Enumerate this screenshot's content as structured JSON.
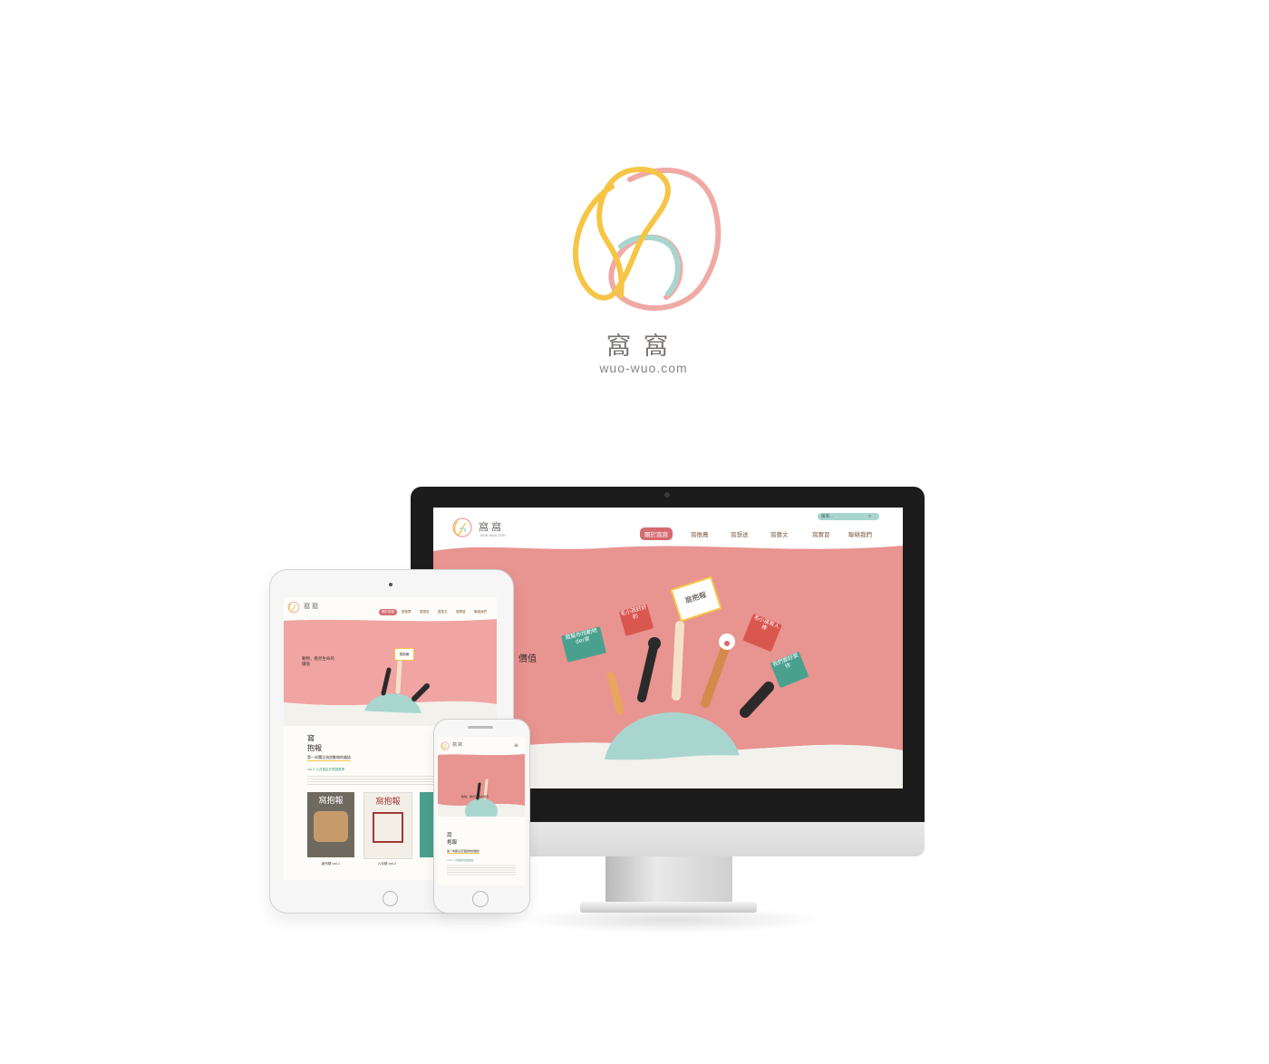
{
  "brand": {
    "title": "窩窩",
    "url": "wuo-wuo.com",
    "colors": {
      "pink": "#f0aaa6",
      "yellow": "#f6c545",
      "mint": "#a8d6cf"
    }
  },
  "site": {
    "logo_title": "窩窩",
    "logo_sub": "wuo-wuo.com",
    "search_placeholder": "搜尋...",
    "nav": [
      "關於窩窩",
      "窩推薦",
      "窩想送",
      "窩藝文",
      "窩實習",
      "聯絡我們"
    ],
    "hero_text": "看見生命的價值",
    "hero_text_visible_desktop": "價值",
    "hero_text_tablet": "動物，看見生命的價值",
    "signs": [
      "窩抱報",
      "窩幫你找動物der家",
      "毛小孩好好的",
      "毛小孩有人疼",
      "我們都好愛你",
      "毛小孩哭哭"
    ],
    "section_title_1": "窩",
    "section_title_2": "抱報",
    "section_sub": "第一本關注流浪動物的雜誌",
    "vol_heading": "vol.2 六月號搶先閱讀看看",
    "magazines": [
      {
        "cover": "窩抱報",
        "caption": "創刊號 vol.1"
      },
      {
        "cover": "窩抱報",
        "caption": "六月號 vol.2"
      }
    ],
    "colors": {
      "accent_red": "#d46a6f",
      "hero_pink": "#e89491",
      "mint": "#a8d6cf",
      "cream": "#fdfcf8"
    }
  }
}
